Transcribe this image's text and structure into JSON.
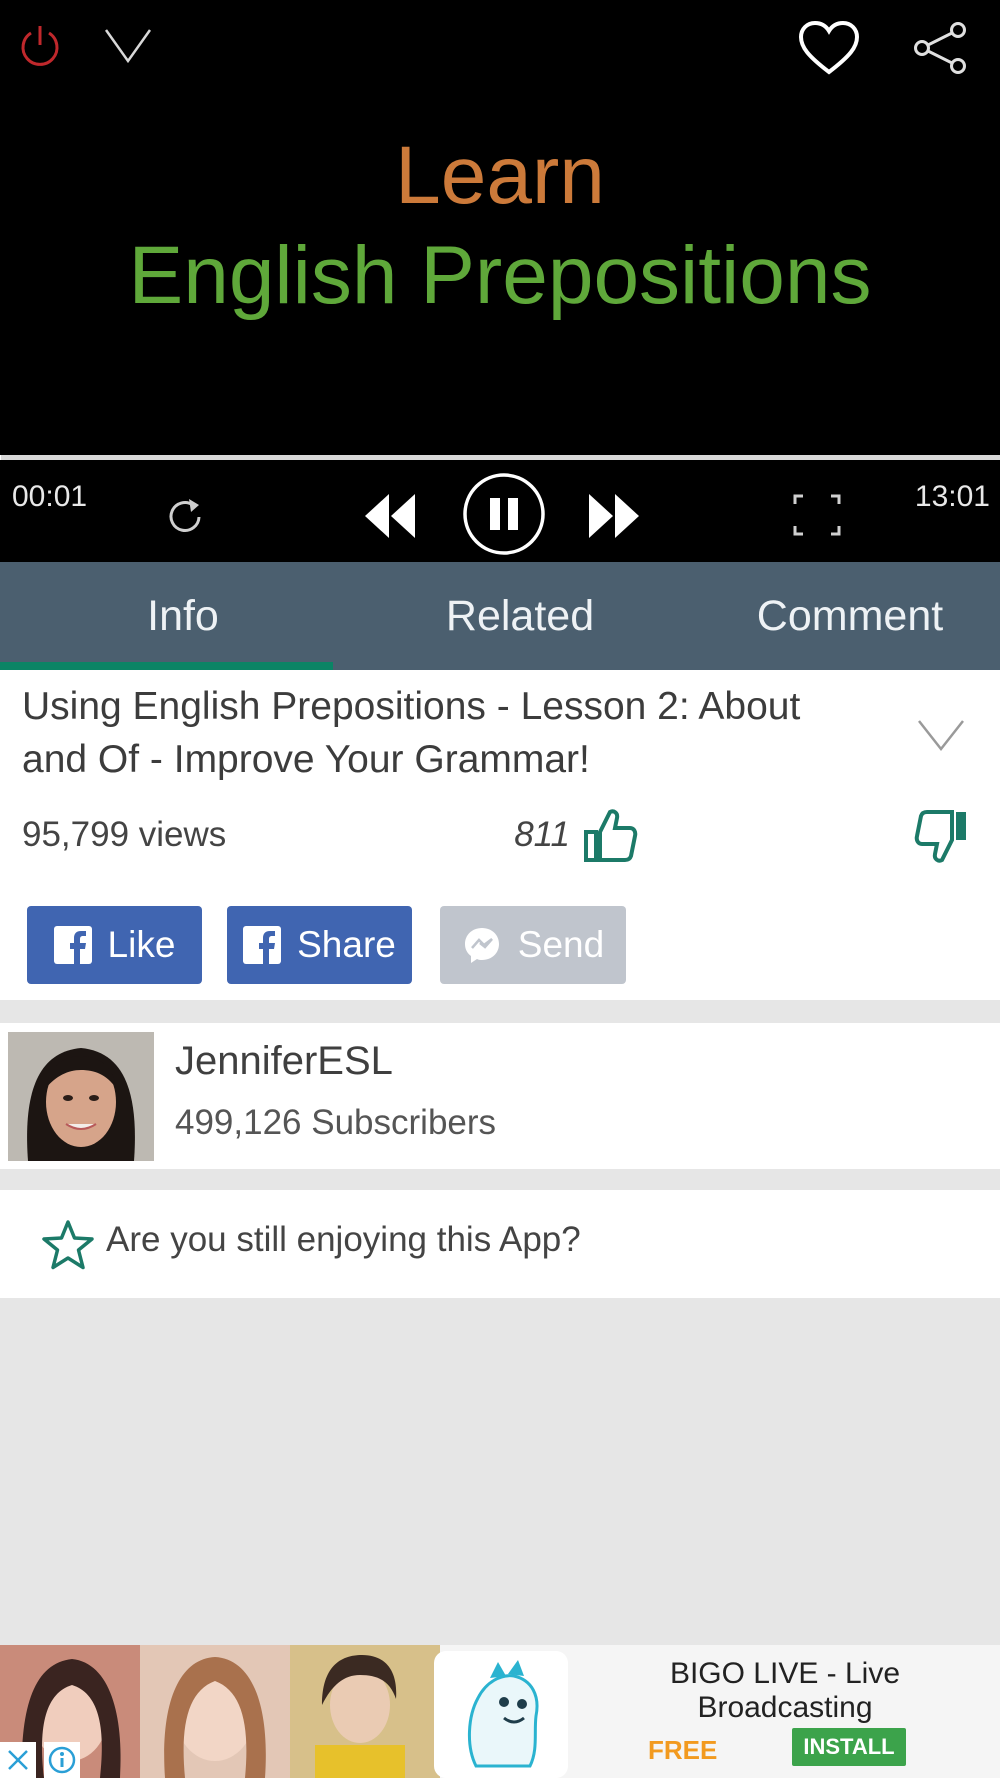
{
  "player": {
    "title_line1": "Learn",
    "title_line2": "English Prepositions",
    "current_time": "00:01",
    "total_time": "13:01",
    "progress": 0.001,
    "colors": {
      "title_line1": "#cc7a3a",
      "title_line2": "#5fa83a",
      "power_icon": "#c0282c"
    },
    "icons": [
      "power-icon",
      "chevron-down-icon",
      "heart-icon",
      "share-icon",
      "replay-icon",
      "rewind-icon",
      "pause-icon",
      "fast-forward-icon",
      "fullscreen-icon"
    ]
  },
  "tabs": [
    {
      "label": "Info",
      "active": true
    },
    {
      "label": "Related",
      "active": false
    },
    {
      "label": "Comment",
      "active": false
    }
  ],
  "video": {
    "title": "Using English Prepositions - Lesson 2: About and Of - Improve Your Grammar!",
    "views": "95,799 views",
    "likes": "811"
  },
  "social": {
    "like_label": "Like",
    "share_label": "Share",
    "send_label": "Send"
  },
  "channel": {
    "name": "JenniferESL",
    "subscribers": "499,126 Subscribers"
  },
  "rating_prompt": {
    "text": "Are you still enjoying this App?"
  },
  "ad": {
    "title": "BIGO LIVE - Live Broadcasting",
    "price": "FREE",
    "cta": "INSTALL"
  },
  "colors": {
    "tab_bar": "#4b5f6f",
    "accent": "#0b8465",
    "facebook": "#4065b1",
    "send_disabled": "#c0c5cd"
  }
}
